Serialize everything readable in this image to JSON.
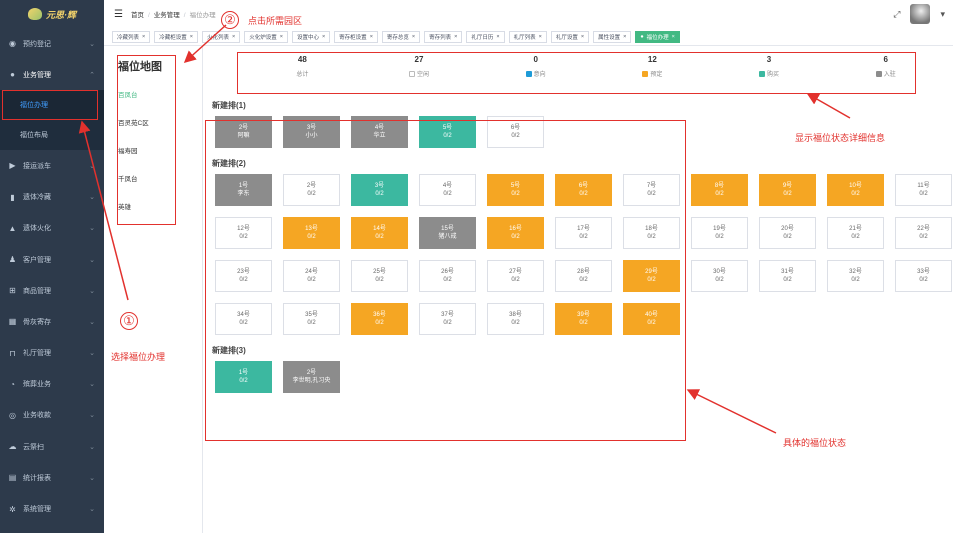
{
  "app": {
    "logo_text": "元思·辉"
  },
  "sidebar": {
    "items": [
      {
        "label": "预约登记",
        "icon": "dashboard-icon",
        "glyph": "◉"
      },
      {
        "label": "业务管理",
        "icon": "business-icon",
        "glyph": "●",
        "open": true,
        "children": [
          {
            "label": "福位办理",
            "active": true
          },
          {
            "label": "福位布局",
            "active": false
          }
        ]
      },
      {
        "label": "接运派车",
        "icon": "truck-icon",
        "glyph": "▶"
      },
      {
        "label": "遗体冷藏",
        "icon": "thermometer-icon",
        "glyph": "▮"
      },
      {
        "label": "遗体火化",
        "icon": "flame-icon",
        "glyph": "▲"
      },
      {
        "label": "客户管理",
        "icon": "user-icon",
        "glyph": "♟"
      },
      {
        "label": "商品管理",
        "icon": "cart-icon",
        "glyph": "⊞"
      },
      {
        "label": "骨灰寄存",
        "icon": "grid-icon",
        "glyph": "▦"
      },
      {
        "label": "礼厅管理",
        "icon": "hall-icon",
        "glyph": "⊓"
      },
      {
        "label": "殡葬业务",
        "icon": "pie-icon",
        "glyph": "◔"
      },
      {
        "label": "业务收款",
        "icon": "money-icon",
        "glyph": "◎"
      },
      {
        "label": "云祭扫",
        "icon": "cloud-icon",
        "glyph": "☁"
      },
      {
        "label": "统计报表",
        "icon": "report-icon",
        "glyph": "▤"
      },
      {
        "label": "系统管理",
        "icon": "gear-icon",
        "glyph": "✲"
      }
    ]
  },
  "breadcrumb": {
    "home": "首页",
    "section": "业务管理",
    "current": "福位办理"
  },
  "tags": [
    {
      "label": "冷藏列表"
    },
    {
      "label": "冷藏柜设置"
    },
    {
      "label": "火化列表"
    },
    {
      "label": "火化炉设置"
    },
    {
      "label": "设置中心"
    },
    {
      "label": "寄存柜设置"
    },
    {
      "label": "寄存总览"
    },
    {
      "label": "寄存列表"
    },
    {
      "label": "礼厅日历"
    },
    {
      "label": "礼厅列表"
    },
    {
      "label": "礼厅设置"
    },
    {
      "label": "属性设置"
    },
    {
      "label": "福位办理",
      "active": true
    }
  ],
  "map": {
    "title": "福位地图",
    "areas": [
      {
        "label": "百凤台",
        "active": true
      },
      {
        "label": "百灵苑C区"
      },
      {
        "label": "福寿园"
      },
      {
        "label": "千凤台"
      },
      {
        "label": "英雄"
      }
    ]
  },
  "colors": {
    "teal": "#3cb8a0",
    "orange": "#f5a623",
    "gray": "#8c8c8c",
    "accent": "#42b983",
    "annotation": "#e2312d"
  },
  "stats": [
    {
      "num": "48",
      "label": "总计",
      "swatch": "none"
    },
    {
      "num": "27",
      "label": "空闲",
      "swatch": "empty"
    },
    {
      "num": "0",
      "label": "意向",
      "swatch": "#1e9bd7"
    },
    {
      "num": "12",
      "label": "预定",
      "swatch": "#f5a623"
    },
    {
      "num": "3",
      "label": "购买",
      "swatch": "#3cb8a0"
    },
    {
      "num": "6",
      "label": "入驻",
      "swatch": "#8c8c8c"
    }
  ],
  "rows": [
    {
      "title": "新建排(1)",
      "cells": [
        {
          "no": "2号",
          "sub": "阿嘛",
          "status": "gray"
        },
        {
          "no": "3号",
          "sub": "小小",
          "status": "gray"
        },
        {
          "no": "4号",
          "sub": "华立",
          "status": "gray"
        },
        {
          "no": "5号",
          "sub": "0/2",
          "status": "teal"
        },
        {
          "no": "6号",
          "sub": "0/2",
          "status": "empty"
        }
      ]
    },
    {
      "title": "新建排(2)",
      "cells": [
        {
          "no": "1号",
          "sub": "李东",
          "status": "gray"
        },
        {
          "no": "2号",
          "sub": "0/2",
          "status": "empty"
        },
        {
          "no": "3号",
          "sub": "0/2",
          "status": "teal"
        },
        {
          "no": "4号",
          "sub": "0/2",
          "status": "empty"
        },
        {
          "no": "5号",
          "sub": "0/2",
          "status": "orange"
        },
        {
          "no": "6号",
          "sub": "0/2",
          "status": "orange"
        },
        {
          "no": "7号",
          "sub": "0/2",
          "status": "empty"
        },
        {
          "no": "8号",
          "sub": "0/2",
          "status": "orange"
        },
        {
          "no": "9号",
          "sub": "0/2",
          "status": "orange"
        },
        {
          "no": "10号",
          "sub": "0/2",
          "status": "orange"
        },
        {
          "no": "11号",
          "sub": "0/2",
          "status": "empty"
        },
        {
          "no": "12号",
          "sub": "0/2",
          "status": "empty"
        },
        {
          "no": "13号",
          "sub": "0/2",
          "status": "orange"
        },
        {
          "no": "14号",
          "sub": "0/2",
          "status": "orange"
        },
        {
          "no": "15号",
          "sub": "猪八戒",
          "status": "gray"
        },
        {
          "no": "16号",
          "sub": "0/2",
          "status": "orange"
        },
        {
          "no": "17号",
          "sub": "0/2",
          "status": "empty"
        },
        {
          "no": "18号",
          "sub": "0/2",
          "status": "empty"
        },
        {
          "no": "19号",
          "sub": "0/2",
          "status": "empty"
        },
        {
          "no": "20号",
          "sub": "0/2",
          "status": "empty"
        },
        {
          "no": "21号",
          "sub": "0/2",
          "status": "empty"
        },
        {
          "no": "22号",
          "sub": "0/2",
          "status": "empty"
        },
        {
          "no": "23号",
          "sub": "0/2",
          "status": "empty"
        },
        {
          "no": "24号",
          "sub": "0/2",
          "status": "empty"
        },
        {
          "no": "25号",
          "sub": "0/2",
          "status": "empty"
        },
        {
          "no": "26号",
          "sub": "0/2",
          "status": "empty"
        },
        {
          "no": "27号",
          "sub": "0/2",
          "status": "empty"
        },
        {
          "no": "28号",
          "sub": "0/2",
          "status": "empty"
        },
        {
          "no": "29号",
          "sub": "0/2",
          "status": "orange"
        },
        {
          "no": "30号",
          "sub": "0/2",
          "status": "empty"
        },
        {
          "no": "31号",
          "sub": "0/2",
          "status": "empty"
        },
        {
          "no": "32号",
          "sub": "0/2",
          "status": "empty"
        },
        {
          "no": "33号",
          "sub": "0/2",
          "status": "empty"
        },
        {
          "no": "34号",
          "sub": "0/2",
          "status": "empty"
        },
        {
          "no": "35号",
          "sub": "0/2",
          "status": "empty"
        },
        {
          "no": "36号",
          "sub": "0/2",
          "status": "orange"
        },
        {
          "no": "37号",
          "sub": "0/2",
          "status": "empty"
        },
        {
          "no": "38号",
          "sub": "0/2",
          "status": "empty"
        },
        {
          "no": "39号",
          "sub": "0/2",
          "status": "orange"
        },
        {
          "no": "40号",
          "sub": "0/2",
          "status": "orange"
        }
      ]
    },
    {
      "title": "新建排(3)",
      "cells": [
        {
          "no": "1号",
          "sub": "0/2",
          "status": "teal"
        },
        {
          "no": "2号",
          "sub": "李世明,孔习央",
          "status": "gray"
        }
      ]
    }
  ],
  "annotations": {
    "step1_num": "①",
    "step1_text": "选择福位办理",
    "step2_num": "②",
    "step2_text": "点击所需园区",
    "stats_text": "显示福位状态详细信息",
    "grid_text": "具体的福位状态"
  }
}
